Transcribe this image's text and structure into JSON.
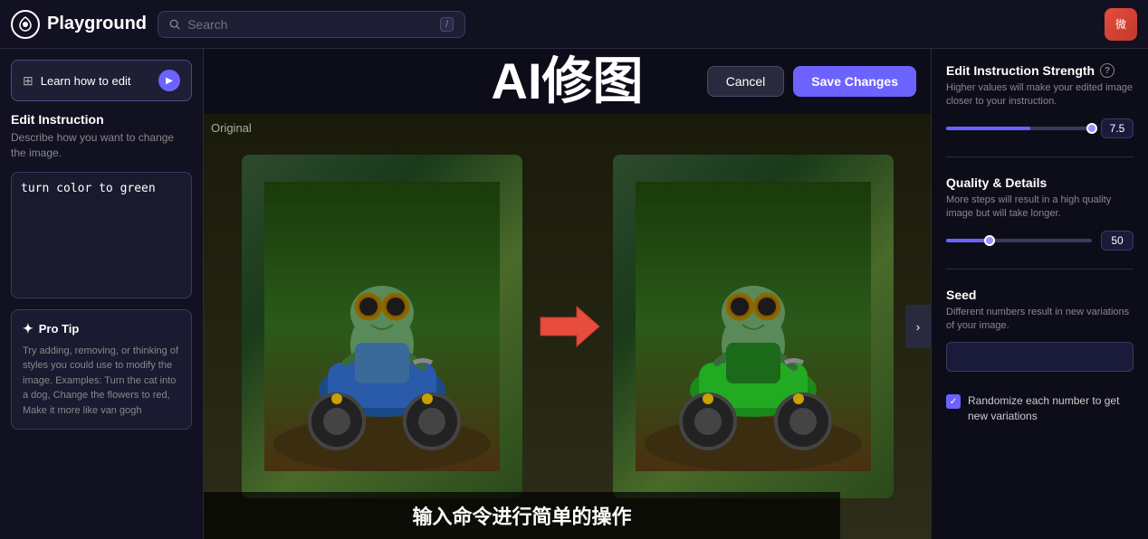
{
  "topbar": {
    "logo_icon": "◐",
    "logo_text": "Playground",
    "search_placeholder": "Search",
    "search_slash": "/",
    "avatar_emoji": "微"
  },
  "sidebar": {
    "learn_btn_label": "Learn how to edit",
    "edit_instruction_label": "Edit Instruction",
    "edit_instruction_desc": "Describe how you want to change the image.",
    "instruction_value": "turn color to green",
    "pro_tip_label": "Pro Tip",
    "pro_tip_text": "Try adding, removing, or thinking of styles you could use to modify the image. Examples: Turn the cat into a dog, Change the flowers to red, Make it more like van gogh"
  },
  "center": {
    "main_title": "AI修图",
    "cancel_label": "Cancel",
    "save_label": "Save Changes",
    "original_label": "Original",
    "bottom_text": "输入命令进行简单的操作"
  },
  "right_panel": {
    "strength_title": "Edit Instruction Strength",
    "strength_desc": "Higher values will make your edited image closer to your instruction.",
    "strength_value": "7.5",
    "quality_title": "Quality & Details",
    "quality_desc": "More steps will result in a high quality image but will take longer.",
    "quality_value": "50",
    "seed_title": "Seed",
    "seed_desc": "Different numbers result in new variations of your image.",
    "seed_placeholder": "",
    "randomize_label": "Randomize each number to get new variations"
  }
}
